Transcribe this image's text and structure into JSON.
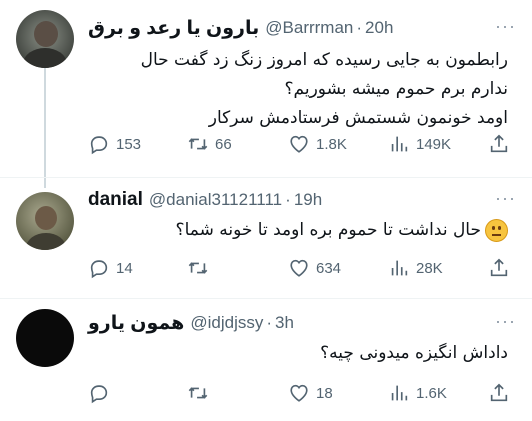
{
  "tweets": [
    {
      "name": "بارون یا رعد و برق",
      "handle": "@Barrrman",
      "time": "20h",
      "lines": [
        "رابطمون به جایی رسیده که امروز زنگ زد گفت حال",
        "ندارم برم حموم میشه بشوریم؟",
        "اومد خونمون شستمش فرستادمش سرکار"
      ],
      "replies": "153",
      "retweets": "66",
      "likes": "1.8K",
      "views": "149K"
    },
    {
      "name": "danial",
      "handle": "@danial31121111",
      "time": "19h",
      "lines": [
        "حال نداشت تا حموم بره اومد تا خونه شما؟"
      ],
      "replies": "14",
      "retweets": "",
      "likes": "634",
      "views": "28K"
    },
    {
      "name": "همون یارو",
      "handle": "@idjdjssy",
      "time": "3h",
      "lines": [
        "داداش انگیزه میدونی چیه؟"
      ],
      "replies": "",
      "retweets": "",
      "likes": "18",
      "views": "1.6K"
    }
  ],
  "more_glyph": "···",
  "dot_glyph": "·",
  "icons": [
    "reply-icon",
    "retweet-icon",
    "like-icon",
    "views-icon",
    "share-icon"
  ],
  "colors": {
    "secondary_text": "#536471",
    "thread_line": "#cfd9de",
    "avatar3": "#0a0a0a"
  }
}
